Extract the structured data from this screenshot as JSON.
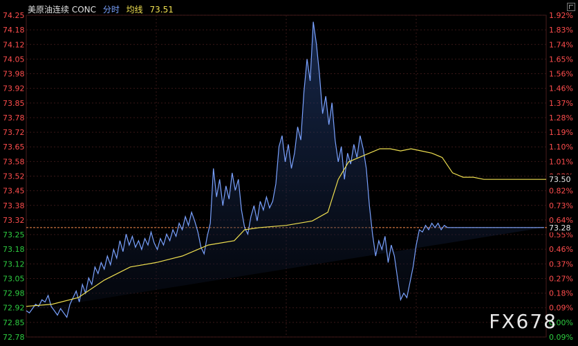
{
  "header": {
    "instrument": "美原油连续 CONC",
    "mode_label": "分时",
    "avg_label": "均线",
    "avg_value": "73.51"
  },
  "watermark": "FX678",
  "colors": {
    "price_line": "#7aa2ff",
    "avg_line": "#f0e050",
    "up": "#ff4d4d",
    "down": "#2ecc40",
    "ref_line": "#ff9050",
    "grid": "#3a1818",
    "background": "#000000"
  },
  "chart_data": {
    "type": "line",
    "title": "",
    "xlabel": "",
    "ylabel": "",
    "ylim": [
      72.78,
      74.25
    ],
    "grid": true,
    "reference_price": 73.28,
    "left_ticks": [
      "74.25",
      "74.18",
      "74.12",
      "74.05",
      "73.98",
      "73.92",
      "73.85",
      "73.78",
      "73.72",
      "73.65",
      "73.58",
      "73.52",
      "73.45",
      "73.38",
      "73.32",
      "73.25",
      "73.18",
      "73.12",
      "73.05",
      "72.98",
      "72.92",
      "72.85",
      "72.78"
    ],
    "right_ticks": [
      "1.92%",
      "1.83%",
      "1.74%",
      "1.65%",
      "1.56%",
      "1.46%",
      "1.37%",
      "1.28%",
      "1.19%",
      "1.10%",
      "1.01%",
      "0.92%",
      "0.82%",
      "0.73%",
      "0.64%",
      "0.55%",
      "0.46%",
      "0.37%",
      "0.27%",
      "0.18%",
      "0.09%",
      "0.00%",
      "0.09%"
    ],
    "last_price_label": "73.28",
    "last_avg_label": "73.50",
    "price_series": {
      "x": [
        0,
        0.006,
        0.012,
        0.018,
        0.024,
        0.03,
        0.036,
        0.042,
        0.048,
        0.054,
        0.06,
        0.066,
        0.072,
        0.078,
        0.084,
        0.09,
        0.096,
        0.102,
        0.108,
        0.114,
        0.12,
        0.126,
        0.132,
        0.138,
        0.144,
        0.15,
        0.156,
        0.162,
        0.168,
        0.174,
        0.18,
        0.186,
        0.192,
        0.198,
        0.204,
        0.21,
        0.216,
        0.222,
        0.228,
        0.234,
        0.24,
        0.246,
        0.252,
        0.258,
        0.264,
        0.27,
        0.276,
        0.282,
        0.288,
        0.294,
        0.3,
        0.306,
        0.312,
        0.318,
        0.324,
        0.33,
        0.336,
        0.342,
        0.348,
        0.354,
        0.36,
        0.366,
        0.372,
        0.378,
        0.384,
        0.39,
        0.396,
        0.402,
        0.408,
        0.414,
        0.42,
        0.426,
        0.432,
        0.438,
        0.444,
        0.45,
        0.456,
        0.462,
        0.468,
        0.474,
        0.48,
        0.486,
        0.492,
        0.498,
        0.504,
        0.51,
        0.516,
        0.522,
        0.528,
        0.534,
        0.54,
        0.546,
        0.552,
        0.558,
        0.564,
        0.57,
        0.576,
        0.582,
        0.588,
        0.594,
        0.6,
        0.606,
        0.612,
        0.618,
        0.624,
        0.63,
        0.636,
        0.642,
        0.648,
        0.654,
        0.66,
        0.666,
        0.672,
        0.678,
        0.684,
        0.69,
        0.696,
        0.702,
        0.708,
        0.714,
        0.72,
        0.726,
        0.732,
        0.738,
        0.744,
        0.75,
        0.756,
        0.762,
        0.768,
        0.774,
        0.78,
        0.786,
        0.792,
        0.798,
        0.804,
        0.81,
        0.816,
        0.822,
        0.828,
        0.834,
        0.84,
        0.846,
        0.852,
        0.858,
        0.864,
        0.87,
        0.876,
        0.882,
        0.888,
        0.894,
        0.9,
        0.906,
        0.912,
        0.918,
        0.924,
        0.93,
        0.936,
        0.942,
        0.948,
        0.954,
        0.96,
        0.966,
        0.972,
        0.978,
        0.984,
        0.99,
        0.996,
        1.0
      ],
      "y": [
        72.9,
        72.89,
        72.91,
        72.93,
        72.92,
        72.95,
        72.94,
        72.97,
        72.92,
        72.9,
        72.88,
        72.91,
        72.89,
        72.87,
        72.93,
        72.96,
        72.99,
        72.94,
        73.02,
        72.98,
        73.05,
        73.02,
        73.1,
        73.07,
        73.12,
        73.09,
        73.15,
        73.11,
        73.18,
        73.14,
        73.22,
        73.17,
        73.25,
        73.2,
        73.24,
        73.19,
        73.22,
        73.18,
        73.23,
        73.2,
        73.26,
        73.21,
        73.18,
        73.23,
        73.2,
        73.25,
        73.22,
        73.27,
        73.24,
        73.3,
        73.27,
        73.33,
        73.29,
        73.35,
        73.31,
        73.26,
        73.19,
        73.16,
        73.24,
        73.3,
        73.55,
        73.42,
        73.5,
        73.38,
        73.47,
        73.41,
        73.53,
        73.45,
        73.5,
        73.36,
        73.28,
        73.25,
        73.33,
        73.38,
        73.31,
        73.4,
        73.36,
        73.42,
        73.37,
        73.4,
        73.48,
        73.65,
        73.7,
        73.58,
        73.66,
        73.55,
        73.62,
        73.74,
        73.68,
        73.9,
        74.05,
        73.95,
        74.22,
        74.12,
        73.98,
        73.8,
        73.88,
        73.75,
        73.85,
        73.68,
        73.58,
        73.65,
        73.5,
        73.62,
        73.57,
        73.66,
        73.6,
        73.7,
        73.64,
        73.55,
        73.38,
        73.25,
        73.15,
        73.22,
        73.18,
        73.24,
        73.12,
        73.2,
        73.15,
        73.05,
        72.95,
        72.98,
        72.96,
        73.03,
        73.1,
        73.2,
        73.27,
        73.26,
        73.29,
        73.27,
        73.3,
        73.28,
        73.3,
        73.27,
        73.29,
        73.28,
        73.28,
        73.28,
        73.28,
        73.28,
        73.28,
        73.28,
        73.28,
        73.28,
        73.28,
        73.28,
        73.28,
        73.28,
        73.28,
        73.28,
        73.28,
        73.28,
        73.28,
        73.28,
        73.28,
        73.28,
        73.28,
        73.28,
        73.28,
        73.28,
        73.28,
        73.28,
        73.28,
        73.28,
        73.28,
        73.28,
        73.28
      ]
    },
    "avg_series": {
      "x": [
        0,
        0.05,
        0.1,
        0.15,
        0.2,
        0.25,
        0.3,
        0.35,
        0.4,
        0.42,
        0.45,
        0.5,
        0.55,
        0.58,
        0.6,
        0.62,
        0.64,
        0.66,
        0.68,
        0.7,
        0.72,
        0.74,
        0.76,
        0.78,
        0.8,
        0.82,
        0.84,
        0.86,
        0.88,
        0.9,
        1.0
      ],
      "y": [
        72.92,
        72.93,
        72.96,
        73.04,
        73.1,
        73.12,
        73.15,
        73.2,
        73.22,
        73.27,
        73.28,
        73.29,
        73.31,
        73.35,
        73.5,
        73.58,
        73.6,
        73.62,
        73.64,
        73.64,
        73.63,
        73.64,
        73.63,
        73.62,
        73.6,
        73.53,
        73.51,
        73.51,
        73.5,
        73.5,
        73.5
      ]
    }
  }
}
